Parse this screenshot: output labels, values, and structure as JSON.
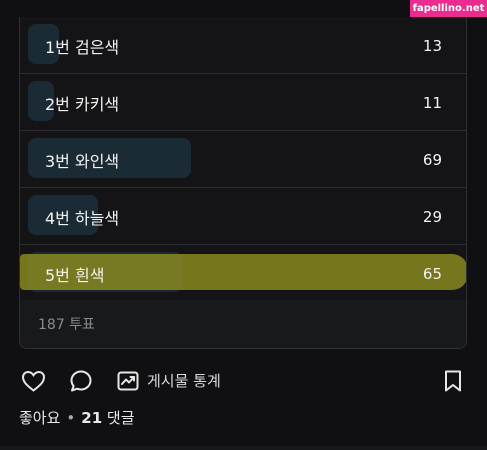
{
  "watermark": "fapellino.net",
  "poll": {
    "options": [
      {
        "label": "1번 검은색",
        "votes": "13",
        "fraction": 0.07
      },
      {
        "label": "2번 카키색",
        "votes": "11",
        "fraction": 0.06
      },
      {
        "label": "3번 와인색",
        "votes": "69",
        "fraction": 0.37
      },
      {
        "label": "4번 하늘색",
        "votes": "29",
        "fraction": 0.16
      },
      {
        "label": "5번 흰색",
        "votes": "65",
        "fraction": 0.35
      }
    ],
    "total": "187 투표",
    "highlight_color": "#8c8c1e"
  },
  "actions": {
    "stats_label": "게시물 통계"
  },
  "meta": {
    "like_label": "좋아요",
    "comment_count": "21",
    "comment_label": "댓글"
  },
  "colors": {
    "background": "#101012",
    "bar": "#1b2b35",
    "border": "#2f3034"
  },
  "icons": [
    "heart-icon",
    "comment-icon",
    "stats-icon",
    "bookmark-icon"
  ]
}
